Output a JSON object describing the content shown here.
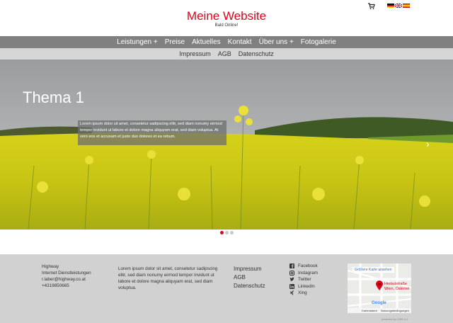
{
  "header": {
    "title": "Meine Website",
    "subtitle": "Bald Online!",
    "cart_icon": "shopping-cart-icon",
    "flags": [
      "de",
      "en",
      "es"
    ]
  },
  "mainnav": {
    "items": [
      {
        "label": "Leistungen +"
      },
      {
        "label": "Preise"
      },
      {
        "label": "Aktuelles"
      },
      {
        "label": "Kontakt"
      },
      {
        "label": "Über uns +"
      },
      {
        "label": "Fotogalerie"
      }
    ]
  },
  "subnav": {
    "items": [
      {
        "label": "Impressum"
      },
      {
        "label": "AGB"
      },
      {
        "label": "Datenschutz"
      }
    ]
  },
  "slider": {
    "title": "Thema 1",
    "caption": "Lorem ipsum dolor sit amet, consetetur sadipscing elitr, sed diam nonumy eirmod tempor invidunt ut labore et dolore magna aliquyam erat, sed diam voluptua. At vero eos et accusam et justo duo dolores et ea rebum.",
    "next_arrow": "›",
    "slide_count": 3,
    "active_slide": 1
  },
  "footer": {
    "company": {
      "name": "Highway",
      "tagline": "Internet Dienstleistungen",
      "email": "r.laber@highway.co.at",
      "phone": "+4319850665"
    },
    "text": "Lorem ipsum dolor sit amet, consetetur sadipscing elitr, sed diam nonumy eirmod tempor invidunt ut labore et dolore magna aliquyam erat, sed diam voluptua.",
    "links": [
      {
        "label": "Impressum"
      },
      {
        "label": "AGB"
      },
      {
        "label": "Datenschutz"
      }
    ],
    "social": [
      {
        "label": "Facebook",
        "icon": "facebook-icon"
      },
      {
        "label": "Instagram",
        "icon": "instagram-icon"
      },
      {
        "label": "Twitter",
        "icon": "twitter-icon"
      },
      {
        "label": "LinkedIn",
        "icon": "linkedin-icon"
      },
      {
        "label": "Xing",
        "icon": "xing-icon"
      }
    ],
    "map": {
      "button": "Größere Karte ansehen",
      "place": "Herbststraße",
      "place2": "Wien, Österrei",
      "brand": "Google",
      "footer1": "Kartendaten",
      "footer2": "Nutzungsbedingungen"
    },
    "powered": "powered by CMS 2.0"
  },
  "colors": {
    "accent": "#e0001a",
    "nav_bg": "#808080",
    "subnav_bg": "#d6d6d6",
    "footer_bg": "#d1d1d1"
  }
}
